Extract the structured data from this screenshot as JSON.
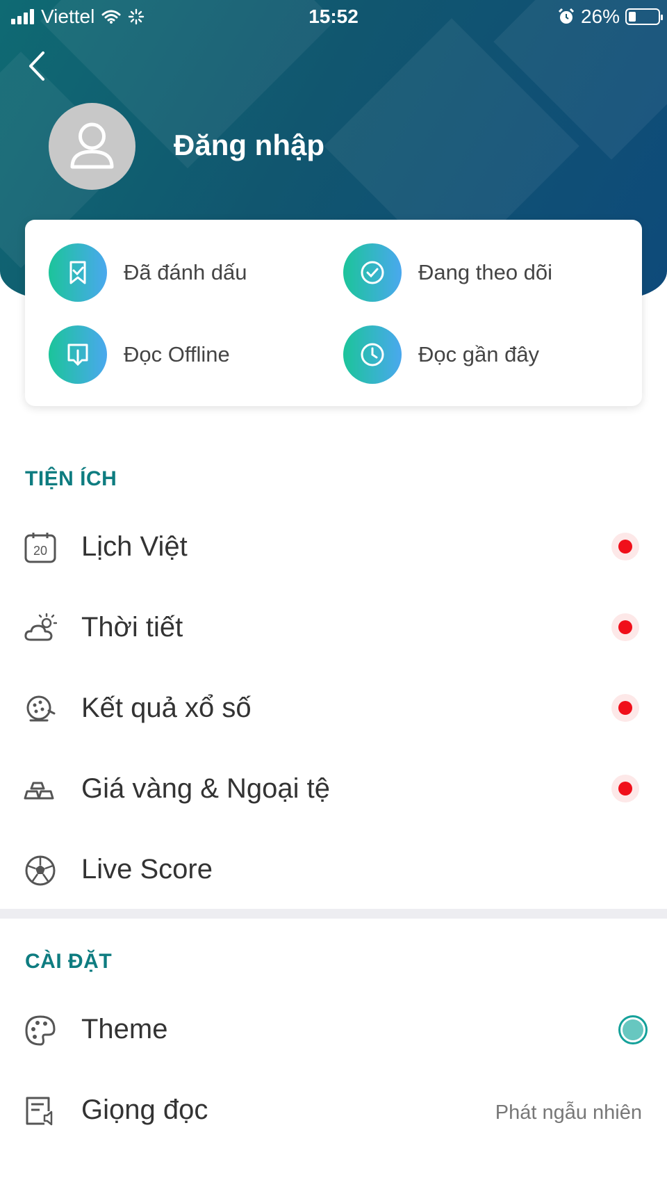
{
  "status_bar": {
    "carrier": "Viettel",
    "time": "15:52",
    "battery": "26%"
  },
  "header": {
    "login_label": "Đăng nhập"
  },
  "quick_actions": [
    {
      "label": "Đã đánh dấu",
      "icon": "bookmark-icon"
    },
    {
      "label": "Đang theo dõi",
      "icon": "check-circle-icon"
    },
    {
      "label": "Đọc Offline",
      "icon": "download-icon"
    },
    {
      "label": "Đọc gần đây",
      "icon": "clock-icon"
    }
  ],
  "utilities": {
    "title": "TIỆN ÍCH",
    "items": [
      {
        "label": "Lịch Việt",
        "icon": "calendar-icon",
        "calendar_day": "20",
        "badge": true
      },
      {
        "label": "Thời tiết",
        "icon": "weather-icon",
        "badge": true
      },
      {
        "label": "Kết quả xổ số",
        "icon": "lottery-icon",
        "badge": true
      },
      {
        "label": "Giá vàng & Ngoại tệ",
        "icon": "gold-bars-icon",
        "badge": true
      },
      {
        "label": "Live Score",
        "icon": "soccer-ball-icon",
        "badge": false
      }
    ]
  },
  "settings": {
    "title": "CÀI ĐẶT",
    "items": [
      {
        "label": "Theme",
        "icon": "palette-icon",
        "accent": "#67c7c0"
      },
      {
        "label": "Giọng đọc",
        "icon": "voice-icon",
        "value": "Phát ngẫu nhiên"
      }
    ]
  },
  "colors": {
    "header_bg": "#11566f",
    "accent_teal": "#0e7c80",
    "badge_red": "#f00f1a"
  }
}
